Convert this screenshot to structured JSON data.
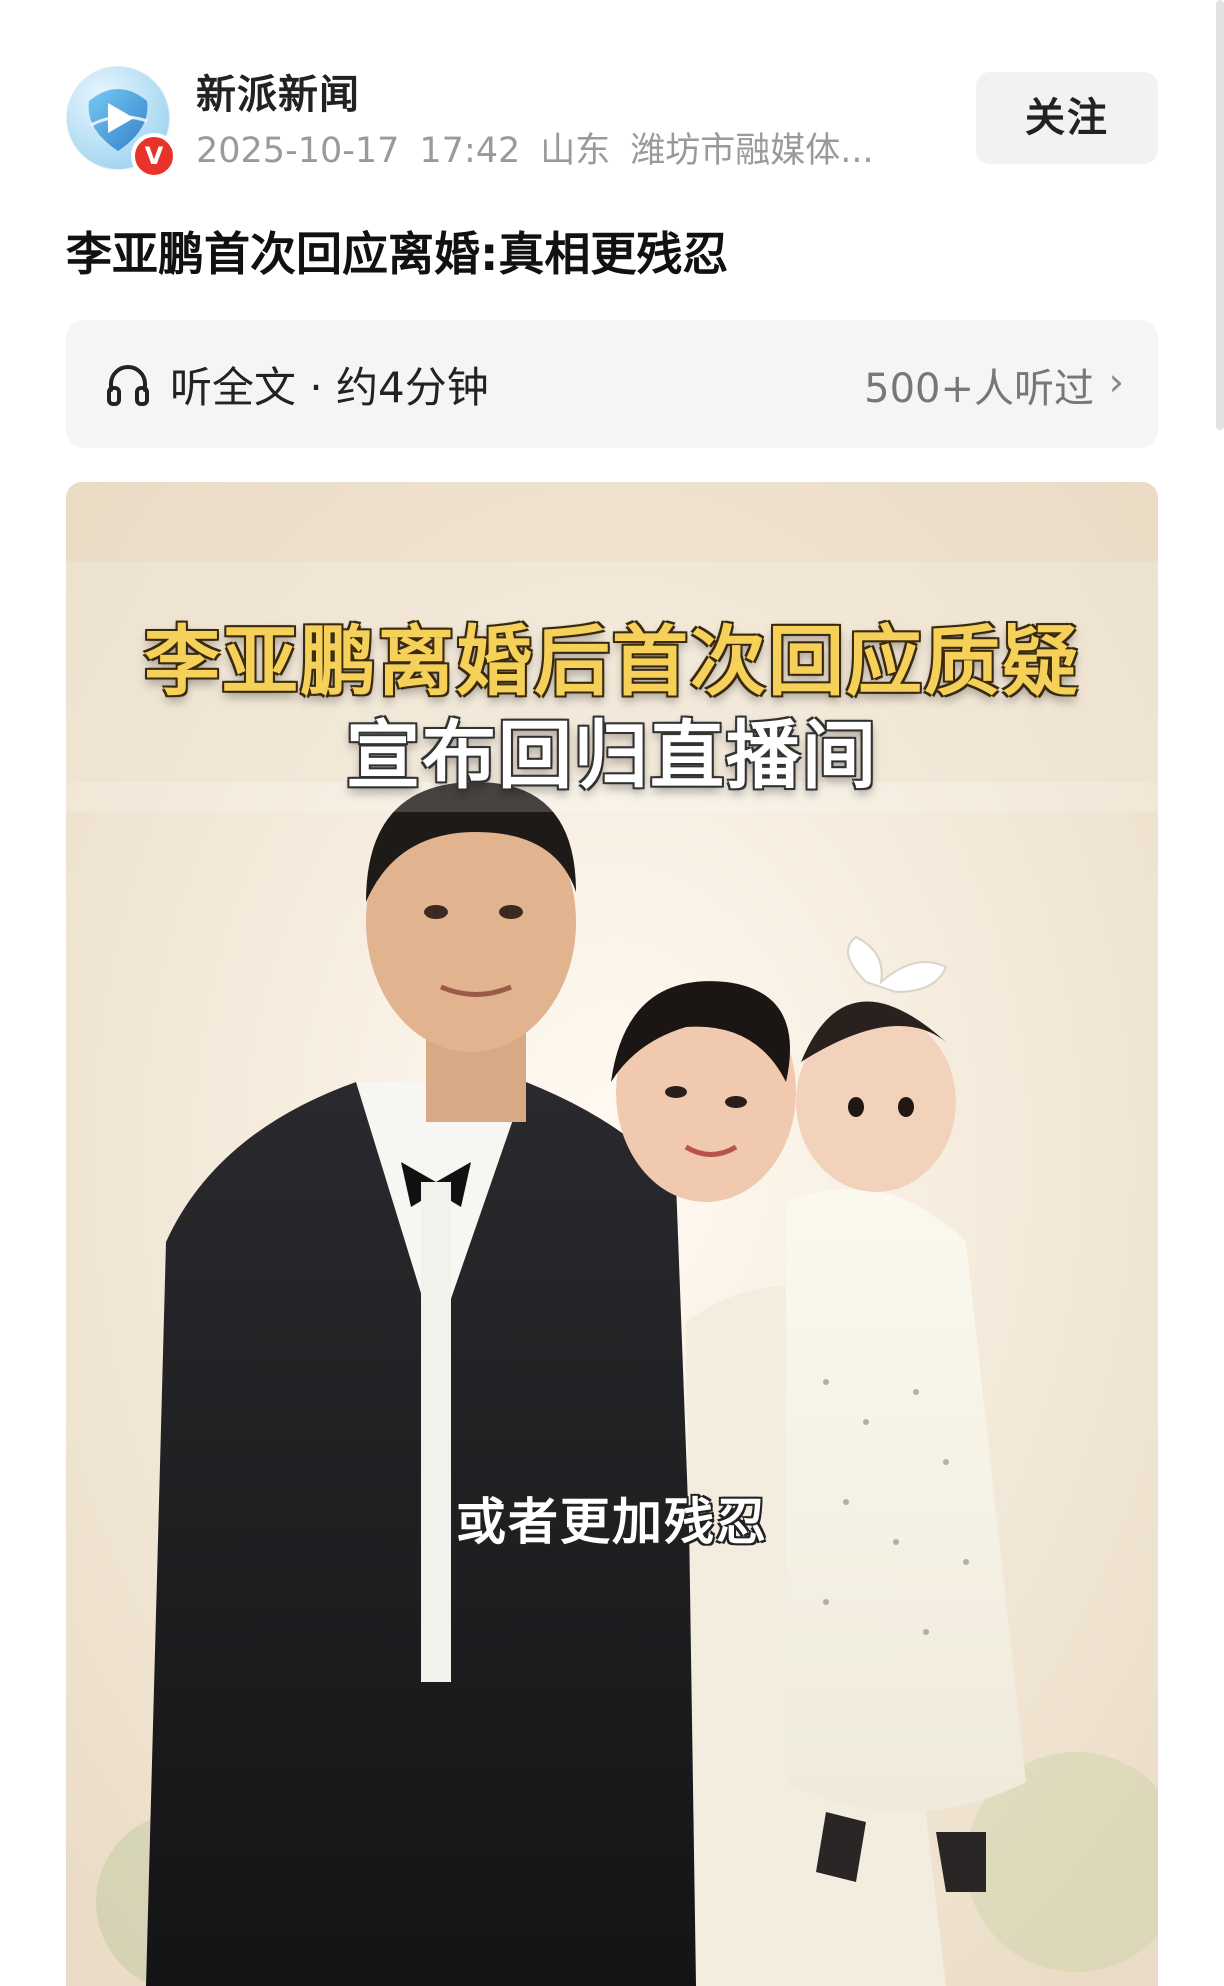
{
  "header": {
    "source_name": "新派新闻",
    "verified_badge": "V",
    "date": "2025-10-17",
    "time": "17:42",
    "region": "山东",
    "publisher": "潍坊市融媒体...",
    "follow_label": "关注",
    "avatar_icon": "play-logo-icon",
    "brand_color": "#2f8fd8"
  },
  "article": {
    "title": "李亚鹏首次回应离婚:真相更残忍"
  },
  "listen": {
    "icon": "headphone-icon",
    "label": "听全文 · 约4分钟",
    "listeners": "500+人听过",
    "chevron": "›"
  },
  "image": {
    "headline_1": "李亚鹏离婚后首次回应质疑",
    "headline_2": "宣布回归直播间",
    "subtitle": "或者更加残忍",
    "headline_color": "#f6d15a"
  }
}
